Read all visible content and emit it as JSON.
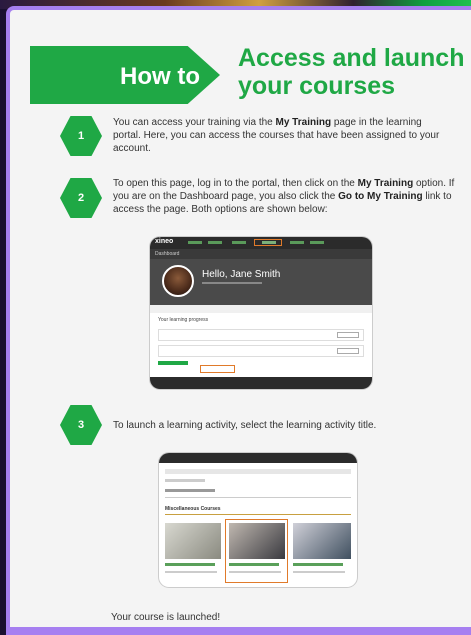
{
  "banner": {
    "label": "How to",
    "heading_line1": "Access and launch",
    "heading_line2": "your courses"
  },
  "colors": {
    "accent": "#1fa845",
    "frame": "#a67ff0",
    "highlight": "#e07a2a"
  },
  "steps": [
    {
      "number": "1",
      "text_before": "You can access your training via the ",
      "bold1": "My Training",
      "text_after": " page in the learning portal. Here, you can access the courses that have been assigned to your account."
    },
    {
      "number": "2",
      "text_before": "To open this page, log in to the portal, then click on the ",
      "bold1": "My Training",
      "text_middle": " option. If you are on the Dashboard page, you also click the ",
      "bold2": "Go to My Training",
      "text_after": " link to access the page. Both options are shown below:"
    },
    {
      "number": "3",
      "text": "To launch a learning activity, select the learning activity title."
    }
  ],
  "screenshot1": {
    "logo": "xineo",
    "section": "Dashboard",
    "greeting": "Hello, Jane Smith",
    "progress_label": "Your learning progress"
  },
  "screenshot2": {
    "section_title": "Miscellaneous Courses"
  },
  "final": "Your course is launched!"
}
